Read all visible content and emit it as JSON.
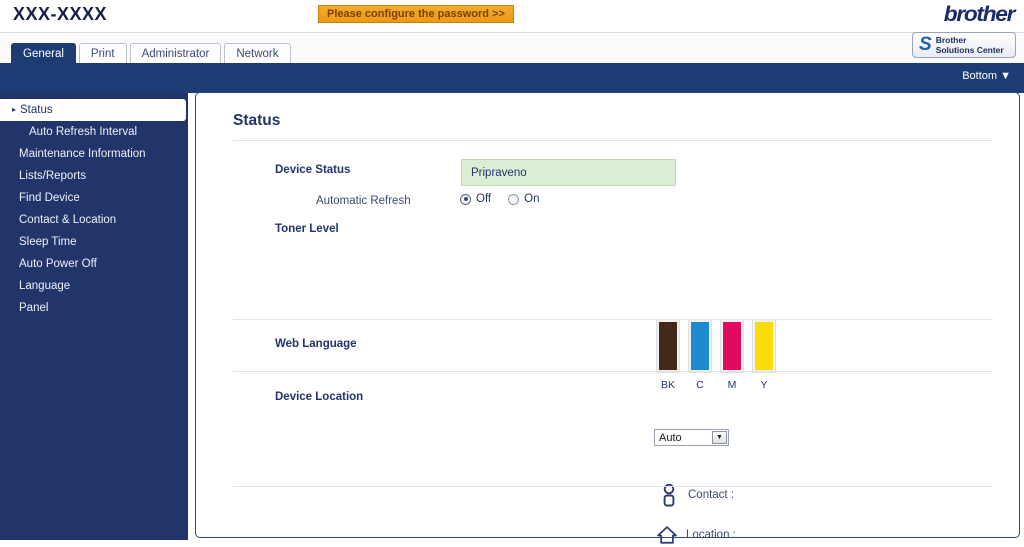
{
  "header": {
    "model_name": "XXX-XXXX",
    "password_button": "Please configure the password >>",
    "brand": "brother",
    "solutions_line1": "Brother",
    "solutions_line2": "Solutions Center",
    "solutions_mark": "S"
  },
  "tabs": [
    {
      "label": "General",
      "active": true
    },
    {
      "label": "Print",
      "active": false
    },
    {
      "label": "Administrator",
      "active": false
    },
    {
      "label": "Network",
      "active": false
    }
  ],
  "bluebar": {
    "bottom_link": "Bottom ▼"
  },
  "sidebar": {
    "items": [
      {
        "label": "Status",
        "active": true,
        "sub": false
      },
      {
        "label": "Auto Refresh Interval",
        "active": false,
        "sub": true
      },
      {
        "label": "Maintenance Information",
        "active": false,
        "sub": false
      },
      {
        "label": "Lists/Reports",
        "active": false,
        "sub": false
      },
      {
        "label": "Find Device",
        "active": false,
        "sub": false
      },
      {
        "label": "Contact & Location",
        "active": false,
        "sub": false
      },
      {
        "label": "Sleep Time",
        "active": false,
        "sub": false
      },
      {
        "label": "Auto Power Off",
        "active": false,
        "sub": false
      },
      {
        "label": "Language",
        "active": false,
        "sub": false
      },
      {
        "label": "Panel",
        "active": false,
        "sub": false
      }
    ]
  },
  "main": {
    "page_title": "Status",
    "device_status_label": "Device Status",
    "device_status_value": "Pripraveno",
    "automatic_refresh_label": "Automatic Refresh",
    "refresh_off_label": "Off",
    "refresh_on_label": "On",
    "refresh_selected": "Off",
    "toner_level_label": "Toner Level",
    "toner": [
      {
        "code": "BK",
        "color": "#432918",
        "level": 100
      },
      {
        "code": "C",
        "color": "#1e8bd0",
        "level": 100
      },
      {
        "code": "M",
        "color": "#e00b5d",
        "level": 100
      },
      {
        "code": "Y",
        "color": "#fcdc06",
        "level": 100
      }
    ],
    "web_language_label": "Web Language",
    "web_language_value": "Auto",
    "web_language_options": [
      "Auto"
    ],
    "device_location_label": "Device Location",
    "contact_label": "Contact :",
    "location_label": "Location :"
  },
  "colors": {
    "nav_blue": "#22356b",
    "bar_blue": "#1e3c74",
    "accent_orange": "#eb9a14",
    "status_green_bg": "#ddedd3"
  }
}
